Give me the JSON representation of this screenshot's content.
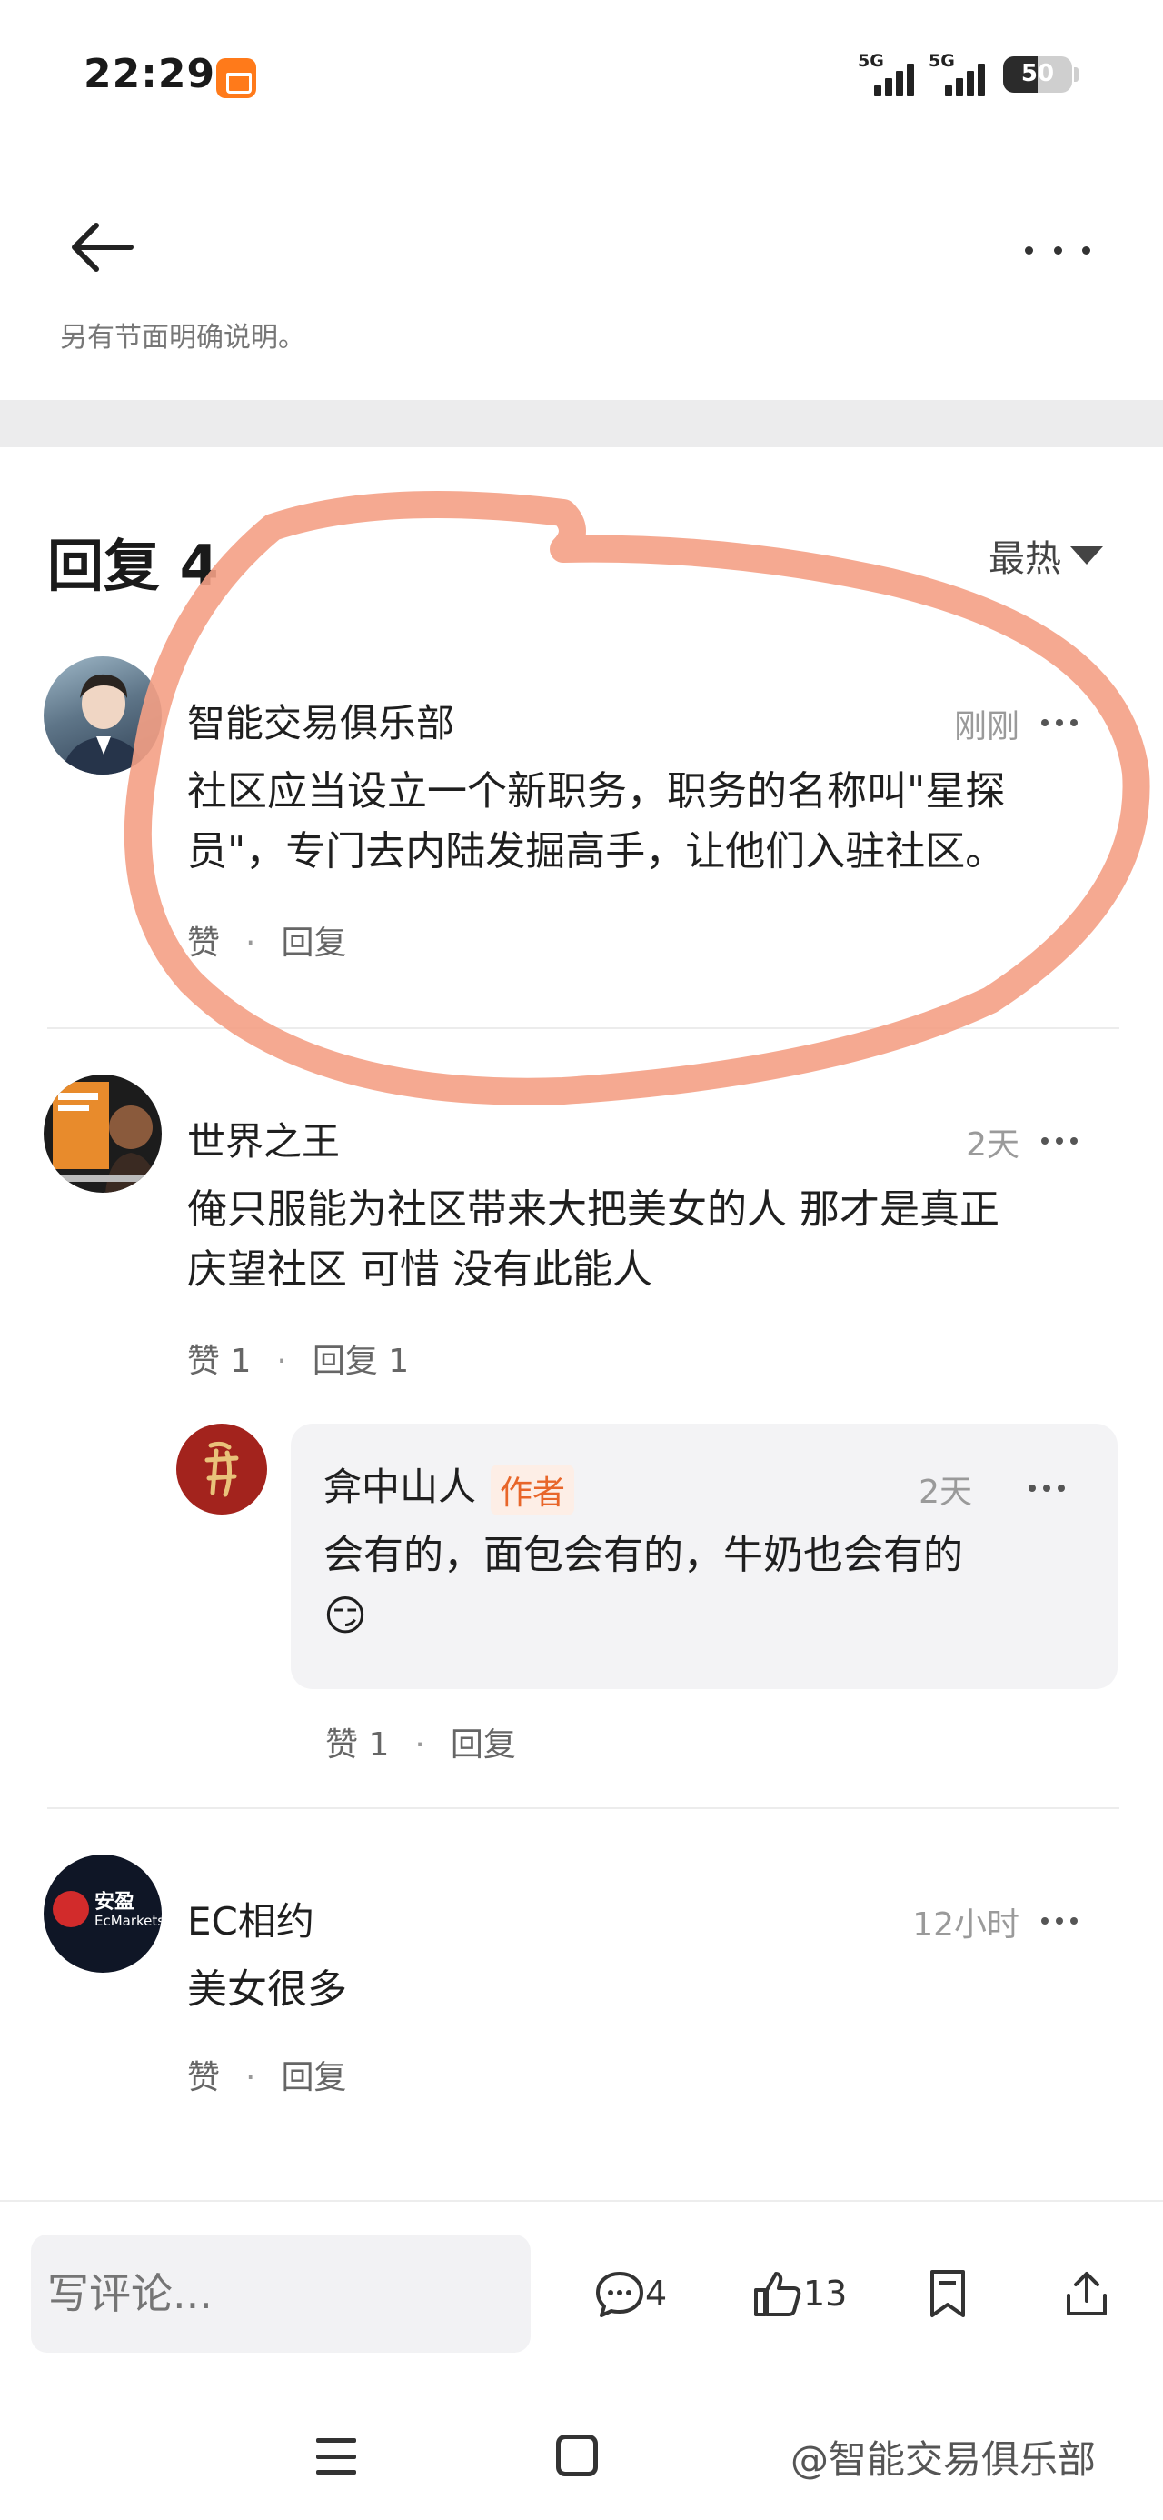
{
  "status_bar": {
    "time": "22:29",
    "network_1": "5G",
    "network_2": "5G",
    "battery": "50",
    "battery_level": 0.5
  },
  "header": {
    "truncated_text": "另有节面明确说明。"
  },
  "replies": {
    "title": "回复 4",
    "sort_label": "最热"
  },
  "comments": [
    {
      "name": "智能交易俱乐部",
      "time": "刚刚",
      "text_line1": "社区应当设立一个新职务，职务的名称叫\"星探",
      "text_line2": "员\"，专门去内陆发掘高手，让他们入驻社区。",
      "like_label": "赞",
      "reply_label": "回复"
    },
    {
      "name": "世界之王",
      "time": "2天",
      "text_line1": "俺只服能为社区带来大把美女的人 那才是真正",
      "text_line2": "庆望社区 可惜 没有此能人",
      "like_label": "赞 1",
      "reply_label": "回复 1",
      "nested_reply": {
        "name": "弇中山人",
        "badge": "作者",
        "time": "2天",
        "text": "会有的，面包会有的，牛奶也会有的",
        "emoji": "😏",
        "like_label": "赞 1",
        "reply_label": "回复"
      }
    },
    {
      "name": "EC相约",
      "time": "12小时",
      "text": "美女很多",
      "like_label": "赞",
      "reply_label": "回复",
      "avatar_text_1": "安盈",
      "avatar_text_2": "EcMarkets"
    }
  ],
  "bottom_bar": {
    "input_placeholder": "写评论...",
    "comment_count": "4",
    "like_count": "13"
  },
  "watermark": "@智能交易俱乐部",
  "colors": {
    "accent": "#e8662a",
    "annotation": "#f4a085",
    "divider": "#ececed"
  }
}
